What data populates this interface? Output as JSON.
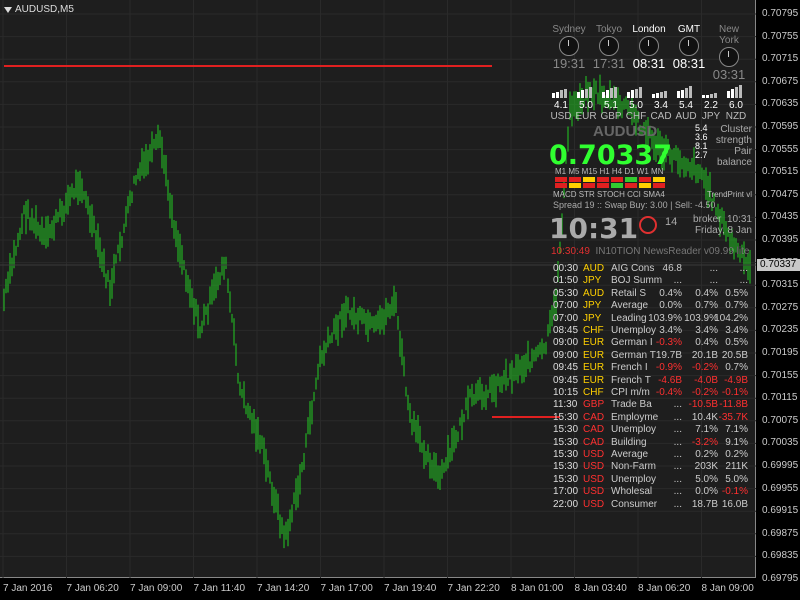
{
  "chart": {
    "symbol_title": "AUDUSD,M5",
    "current_price_tag": "0.70337",
    "y_ticks": [
      "0.70795",
      "0.70755",
      "0.70715",
      "0.70675",
      "0.70635",
      "0.70595",
      "0.70555",
      "0.70515",
      "0.70475",
      "0.70435",
      "0.70395",
      "0.70355",
      "0.70315",
      "0.70275",
      "0.70235",
      "0.70195",
      "0.70155",
      "0.70115",
      "0.70075",
      "0.70035",
      "0.69995",
      "0.69955",
      "0.69915",
      "0.69875",
      "0.69835",
      "0.69795"
    ],
    "x_ticks": [
      "7 Jan 2016",
      "7 Jan 06:20",
      "7 Jan 09:00",
      "7 Jan 11:40",
      "7 Jan 14:20",
      "7 Jan 17:00",
      "7 Jan 19:40",
      "7 Jan 22:20",
      "8 Jan 01:00",
      "8 Jan 03:40",
      "8 Jan 06:20",
      "8 Jan 09:00"
    ],
    "colors": {
      "candles": "#22cc22",
      "level": "#e02020",
      "bg": "#1e1e1e"
    }
  },
  "clocks": [
    {
      "name": "Sydney",
      "time": "19:31",
      "active": false
    },
    {
      "name": "Tokyo",
      "time": "17:31",
      "active": false
    },
    {
      "name": "London",
      "time": "08:31",
      "active": true
    },
    {
      "name": "GMT",
      "time": "08:31",
      "active": true
    },
    {
      "name": "New York",
      "time": "03:31",
      "active": false
    }
  ],
  "strengths": [
    {
      "value": "4.1",
      "currency": "USD"
    },
    {
      "value": "5.0",
      "currency": "EUR"
    },
    {
      "value": "5.1",
      "currency": "GBP"
    },
    {
      "value": "5.0",
      "currency": "CHF"
    },
    {
      "value": "3.4",
      "currency": "CAD"
    },
    {
      "value": "5.4",
      "currency": "AUD"
    },
    {
      "value": "2.2",
      "currency": "JPY"
    },
    {
      "value": "6.0",
      "currency": "NZD"
    }
  ],
  "info": {
    "symbol": "AUDUSD",
    "price": "0.70337",
    "cluster_label_1": "Cluster",
    "cluster_label_2": "strength",
    "pair_label_1": "Pair",
    "pair_label_2": "balance",
    "strength_vals": [
      "5.4",
      "3.6",
      "8.1",
      "2.7"
    ],
    "timeframes": "M1 M5 M15 H1 H4 D1 W1 MN",
    "indicators": "MACD  STR  STOCH  CCI  SMA4",
    "trend_label": "TrendPrint vl",
    "spread_line": "Spread 19 :: Swap Buy: 3.00 | Sell: -4.50",
    "big_time": "10:31",
    "bar_countdown": "14",
    "broker_label": "broker",
    "broker_time": "10:31",
    "broker_day": "Friday, 8 Jan",
    "news_time": "10:30:49",
    "news_title": "IN10TION NewsReader v09.99 lite"
  },
  "news": [
    {
      "time": "00:30",
      "cur": "AUD",
      "ev": "AIG Cons",
      "a": "46.8",
      "f": "...",
      "p": "..."
    },
    {
      "time": "01:50",
      "cur": "JPY",
      "ev": "BOJ Summ",
      "a": "...",
      "f": "...",
      "p": "..."
    },
    {
      "time": "05:30",
      "cur": "AUD",
      "ev": "Retail S",
      "a": "0.4%",
      "f": "0.4%",
      "p": "0.5%"
    },
    {
      "time": "07:00",
      "cur": "JPY",
      "ev": "Average",
      "a": "0.0%",
      "f": "0.7%",
      "p": "0.7%"
    },
    {
      "time": "07:00",
      "cur": "JPY",
      "ev": "Leading",
      "a": "103.9%",
      "f": "103.9%",
      "p": "104.2%"
    },
    {
      "time": "08:45",
      "cur": "CHF",
      "ev": "Unemploy",
      "a": "3.4%",
      "f": "3.4%",
      "p": "3.4%"
    },
    {
      "time": "09:00",
      "cur": "EUR",
      "ev": "German I",
      "a": "-0.3%",
      "f": "0.4%",
      "p": "0.5%"
    },
    {
      "time": "09:00",
      "cur": "EUR",
      "ev": "German T",
      "a": "19.7B",
      "f": "20.1B",
      "p": "20.5B"
    },
    {
      "time": "09:45",
      "cur": "EUR",
      "ev": "French I",
      "a": "-0.9%",
      "f": "-0.2%",
      "p": "0.7%"
    },
    {
      "time": "09:45",
      "cur": "EUR",
      "ev": "French T",
      "a": "-4.6B",
      "f": "-4.0B",
      "p": "-4.9B"
    },
    {
      "time": "10:15",
      "cur": "CHF",
      "ev": "CPI m/m",
      "a": "-0.4%",
      "f": "-0.2%",
      "p": "-0.1%"
    },
    {
      "time": "11:30",
      "cur": "GBP",
      "ev": "Trade Ba",
      "a": "...",
      "f": "-10.5B",
      "p": "-11.8B"
    },
    {
      "time": "15:30",
      "cur": "CAD",
      "ev": "Employme",
      "a": "...",
      "f": "10.4K",
      "p": "-35.7K"
    },
    {
      "time": "15:30",
      "cur": "CAD",
      "ev": "Unemploy",
      "a": "...",
      "f": "7.1%",
      "p": "7.1%"
    },
    {
      "time": "15:30",
      "cur": "CAD",
      "ev": "Building",
      "a": "...",
      "f": "-3.2%",
      "p": "9.1%"
    },
    {
      "time": "15:30",
      "cur": "USD",
      "ev": "Average",
      "a": "...",
      "f": "0.2%",
      "p": "0.2%"
    },
    {
      "time": "15:30",
      "cur": "USD",
      "ev": "Non-Farm",
      "a": "...",
      "f": "203K",
      "p": "211K"
    },
    {
      "time": "15:30",
      "cur": "USD",
      "ev": "Unemploy",
      "a": "...",
      "f": "5.0%",
      "p": "5.0%"
    },
    {
      "time": "17:00",
      "cur": "USD",
      "ev": "Wholesal",
      "a": "...",
      "f": "0.0%",
      "p": "-0.1%"
    },
    {
      "time": "22:00",
      "cur": "USD",
      "ev": "Consumer",
      "a": "...",
      "f": "18.7B",
      "p": "16.0B"
    }
  ]
}
